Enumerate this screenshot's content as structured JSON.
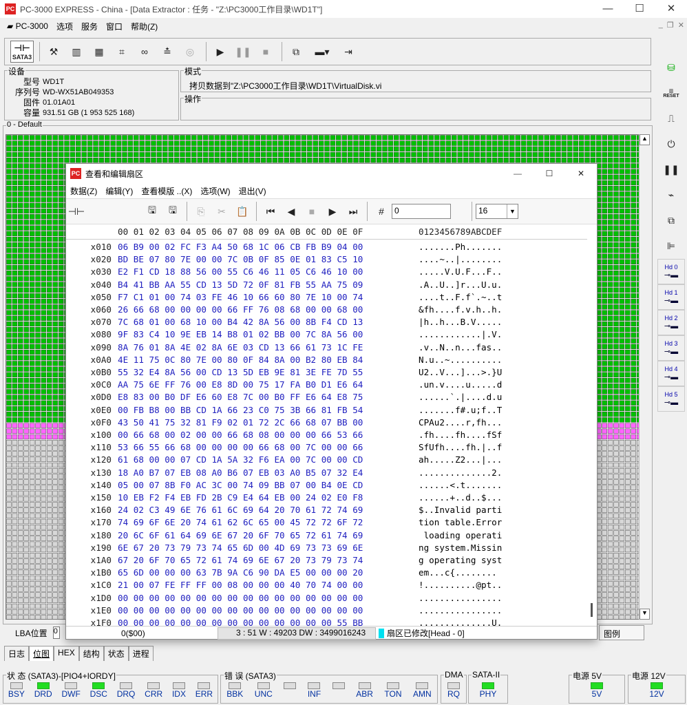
{
  "window": {
    "title": "PC-3000 EXPRESS - China - [Data Extractor : 任务 - \"Z:\\PC3000工作目录\\WD1T\"]",
    "app_icon": "PC"
  },
  "menu": [
    "PC-3000",
    "选项",
    "服务",
    "窗口",
    "帮助(Z)"
  ],
  "device": {
    "group_label": "设备",
    "model_label": "型号",
    "model": "WD1T",
    "serial_label": "序列号",
    "serial": "WD-WX51AB049353",
    "firmware_label": "固件",
    "firmware": "01.01A01",
    "capacity_label": "容量",
    "capacity": "931.51 GB (1 953 525 168)"
  },
  "mode": {
    "label": "模式",
    "text": "拷贝数据到\"Z:\\PC3000工作目录\\WD1T\\VirtualDisk.vi"
  },
  "operation": {
    "label": "操作"
  },
  "map": {
    "label": "0 - Default"
  },
  "toolbar": {
    "sata": "SATA3"
  },
  "dialog": {
    "title": "查看和编辑扇区",
    "menu": [
      "数据(Z)",
      "编辑(Y)",
      "查看模版 ..(X)",
      "选项(W)",
      "退出(V)"
    ],
    "lba_value": "0",
    "cols_value": "16",
    "header_hex": "00 01 02 03 04 05 06 07 08 09 0A 0B 0C 0D 0E 0F",
    "header_ascii": "0123456789ABCDEF",
    "rows": [
      {
        "off": "x010",
        "hex": "06 B9 00 02 FC F3 A4 50 68 1C 06 CB FB B9 04 00",
        "asc": ".......Ph......."
      },
      {
        "off": "x020",
        "hex": "BD BE 07 80 7E 00 00 7C 0B 0F 85 0E 01 83 C5 10",
        "asc": "....~..|........"
      },
      {
        "off": "x030",
        "hex": "E2 F1 CD 18 88 56 00 55 C6 46 11 05 C6 46 10 00",
        "asc": ".....V.U.F...F.."
      },
      {
        "off": "x040",
        "hex": "B4 41 BB AA 55 CD 13 5D 72 0F 81 FB 55 AA 75 09",
        "asc": ".A..U..]r...U.u."
      },
      {
        "off": "x050",
        "hex": "F7 C1 01 00 74 03 FE 46 10 66 60 80 7E 10 00 74",
        "asc": "....t..F.f`.~..t"
      },
      {
        "off": "x060",
        "hex": "26 66 68 00 00 00 00 66 FF 76 08 68 00 00 68 00",
        "asc": "&fh....f.v.h..h."
      },
      {
        "off": "x070",
        "hex": "7C 68 01 00 68 10 00 B4 42 8A 56 00 8B F4 CD 13",
        "asc": "|h..h...B.V....."
      },
      {
        "off": "x080",
        "hex": "9F 83 C4 10 9E EB 14 B8 01 02 BB 00 7C 8A 56 00",
        "asc": "............|.V."
      },
      {
        "off": "x090",
        "hex": "8A 76 01 8A 4E 02 8A 6E 03 CD 13 66 61 73 1C FE",
        "asc": ".v..N..n...fas.."
      },
      {
        "off": "x0A0",
        "hex": "4E 11 75 0C 80 7E 00 80 0F 84 8A 00 B2 80 EB 84",
        "asc": "N.u..~.........."
      },
      {
        "off": "x0B0",
        "hex": "55 32 E4 8A 56 00 CD 13 5D EB 9E 81 3E FE 7D 55",
        "asc": "U2..V...]...>.}U"
      },
      {
        "off": "x0C0",
        "hex": "AA 75 6E FF 76 00 E8 8D 00 75 17 FA B0 D1 E6 64",
        "asc": ".un.v....u.....d"
      },
      {
        "off": "x0D0",
        "hex": "E8 83 00 B0 DF E6 60 E8 7C 00 B0 FF E6 64 E8 75",
        "asc": "......`.|....d.u"
      },
      {
        "off": "x0E0",
        "hex": "00 FB B8 00 BB CD 1A 66 23 C0 75 3B 66 81 FB 54",
        "asc": ".......f#.u;f..T"
      },
      {
        "off": "x0F0",
        "hex": "43 50 41 75 32 81 F9 02 01 72 2C 66 68 07 BB 00",
        "asc": "CPAu2....r,fh..."
      },
      {
        "off": "x100",
        "hex": "00 66 68 00 02 00 00 66 68 08 00 00 00 66 53 66",
        "asc": ".fh....fh....fSf"
      },
      {
        "off": "x110",
        "hex": "53 66 55 66 68 00 00 00 00 66 68 00 7C 00 00 66",
        "asc": "SfUfh....fh.|..f"
      },
      {
        "off": "x120",
        "hex": "61 68 00 00 07 CD 1A 5A 32 F6 EA 00 7C 00 00 CD",
        "asc": "ah.....Z2...|..."
      },
      {
        "off": "x130",
        "hex": "18 A0 B7 07 EB 08 A0 B6 07 EB 03 A0 B5 07 32 E4",
        "asc": "..............2."
      },
      {
        "off": "x140",
        "hex": "05 00 07 8B F0 AC 3C 00 74 09 BB 07 00 B4 0E CD",
        "asc": "......<.t......."
      },
      {
        "off": "x150",
        "hex": "10 EB F2 F4 EB FD 2B C9 E4 64 EB 00 24 02 E0 F8",
        "asc": "......+..d..$..."
      },
      {
        "off": "x160",
        "hex": "24 02 C3 49 6E 76 61 6C 69 64 20 70 61 72 74 69",
        "asc": "$..Invalid parti"
      },
      {
        "off": "x170",
        "hex": "74 69 6F 6E 20 74 61 62 6C 65 00 45 72 72 6F 72",
        "asc": "tion table.Error"
      },
      {
        "off": "x180",
        "hex": "20 6C 6F 61 64 69 6E 67 20 6F 70 65 72 61 74 69",
        "asc": " loading operati"
      },
      {
        "off": "x190",
        "hex": "6E 67 20 73 79 73 74 65 6D 00 4D 69 73 73 69 6E",
        "asc": "ng system.Missin"
      },
      {
        "off": "x1A0",
        "hex": "67 20 6F 70 65 72 61 74 69 6E 67 20 73 79 73 74",
        "asc": "g operating syst"
      },
      {
        "off": "x1B0",
        "hex": "65 6D 00 00 00 63 7B 9A C6 90 DA E5 00 00 00 20",
        "asc": "em...c{........ "
      },
      {
        "off": "x1C0",
        "hex": "21 00 07 FE FF FF 00 08 00 00 00 40 70 74 00 00",
        "asc": "!..........@pt.."
      },
      {
        "off": "x1D0",
        "hex": "00 00 00 00 00 00 00 00 00 00 00 00 00 00 00 00",
        "asc": "................"
      },
      {
        "off": "x1E0",
        "hex": "00 00 00 00 00 00 00 00 00 00 00 00 00 00 00 00",
        "asc": "................"
      },
      {
        "off": "x1F0",
        "hex": "00 00 00 00 00 00 00 00 00 00 00 00 00 00 55 BB",
        "asc": "..............U."
      }
    ],
    "status_left": "0($00)",
    "status_mid": "3 : 51 W : 49203 DW : 3499016243",
    "status_right": "扇区已修改[Head - 0]"
  },
  "bottom": {
    "lba_label": "LBA位置",
    "lba_value": "0",
    "legend": "图例"
  },
  "tabs": [
    "日志",
    "位图",
    "HEX",
    "结构",
    "状态",
    "进程"
  ],
  "status": {
    "state_label": "状 态 (SATA3)-[PIO4+IORDY]",
    "state_leds": [
      {
        "l": "BSY",
        "on": false
      },
      {
        "l": "DRD",
        "on": true
      },
      {
        "l": "DWF",
        "on": false
      },
      {
        "l": "DSC",
        "on": true
      },
      {
        "l": "DRQ",
        "on": false
      },
      {
        "l": "CRR",
        "on": false
      },
      {
        "l": "IDX",
        "on": false
      },
      {
        "l": "ERR",
        "on": false
      }
    ],
    "err_label": "错 误 (SATA3)",
    "err_leds": [
      {
        "l": "BBK",
        "on": false
      },
      {
        "l": "UNC",
        "on": false
      },
      {
        "l": "",
        "on": false
      },
      {
        "l": "INF",
        "on": false
      },
      {
        "l": "",
        "on": false
      },
      {
        "l": "ABR",
        "on": false
      },
      {
        "l": "TON",
        "on": false
      },
      {
        "l": "AMN",
        "on": false
      }
    ],
    "dma_label": "DMA",
    "dma_led": "RQ",
    "sata_label": "SATA-II",
    "sata_led": "PHY",
    "p5_label": "电源 5V",
    "p5_led": "5V",
    "p12_label": "电源 12V",
    "p12_led": "12V"
  },
  "right_tools": {
    "reset": "RESET",
    "hd": [
      "Hd 0",
      "Hd 1",
      "Hd 2",
      "Hd 3",
      "Hd 4",
      "Hd 5"
    ]
  },
  "colors": {
    "green": "#00c000",
    "pink": "#ff66ff",
    "gray": "#d8d8d8",
    "hexblue": "#2020c0"
  }
}
